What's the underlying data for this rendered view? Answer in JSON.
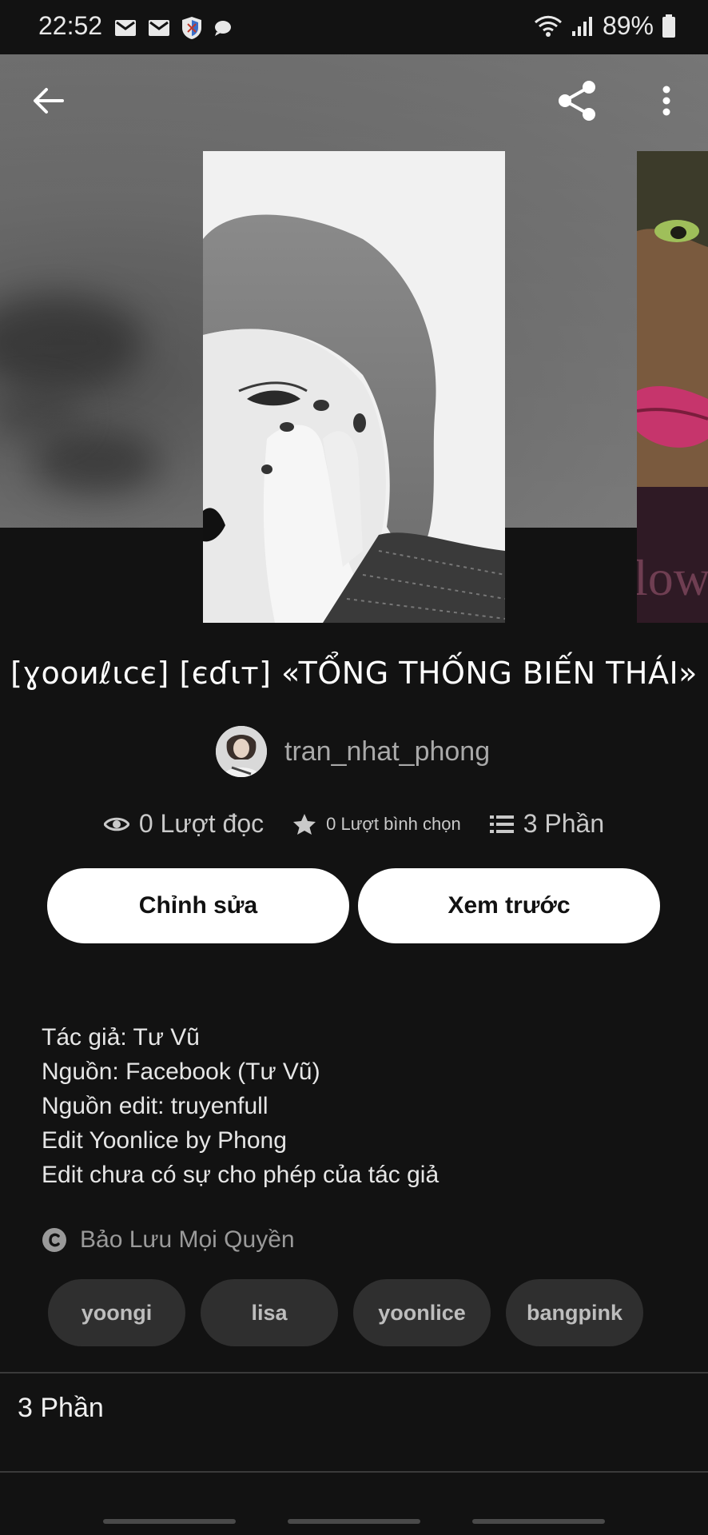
{
  "status_bar": {
    "time": "22:52",
    "battery": "89%"
  },
  "toolbar": {
    "back_icon": "arrow-left-icon",
    "share_icon": "share-icon",
    "more_icon": "more-vertical-icon"
  },
  "story": {
    "title": "[ɣooиℓιcє] [єɗιт] «TỔNG THỐNG BIẾN THÁI»",
    "author": "tran_nhat_phong",
    "stats": {
      "reads": "0 Lượt đọc",
      "votes": "0 Lượt bình chọn",
      "parts": "3 Phần"
    }
  },
  "actions": {
    "edit_label": "Chỉnh sửa",
    "preview_label": "Xem trước"
  },
  "description": {
    "lines": [
      "Tác giả: Tư Vũ",
      "Nguồn: Facebook (Tư Vũ)",
      "Nguồn edit: truyenfull",
      "Edit Yoonlice by Phong",
      "Edit chưa có sự cho phép của tác giả"
    ]
  },
  "copyright": {
    "label": "Bảo Lưu Mọi Quyền"
  },
  "tags": [
    "yoongi",
    "lisa",
    "yoonlice",
    "bangpink"
  ],
  "parts_section": {
    "title": "3 Phần"
  },
  "colors": {
    "background": "#121212",
    "button_bg": "#ffffff",
    "tag_bg": "#2f2f2f",
    "muted_text": "#a9a9a9"
  }
}
